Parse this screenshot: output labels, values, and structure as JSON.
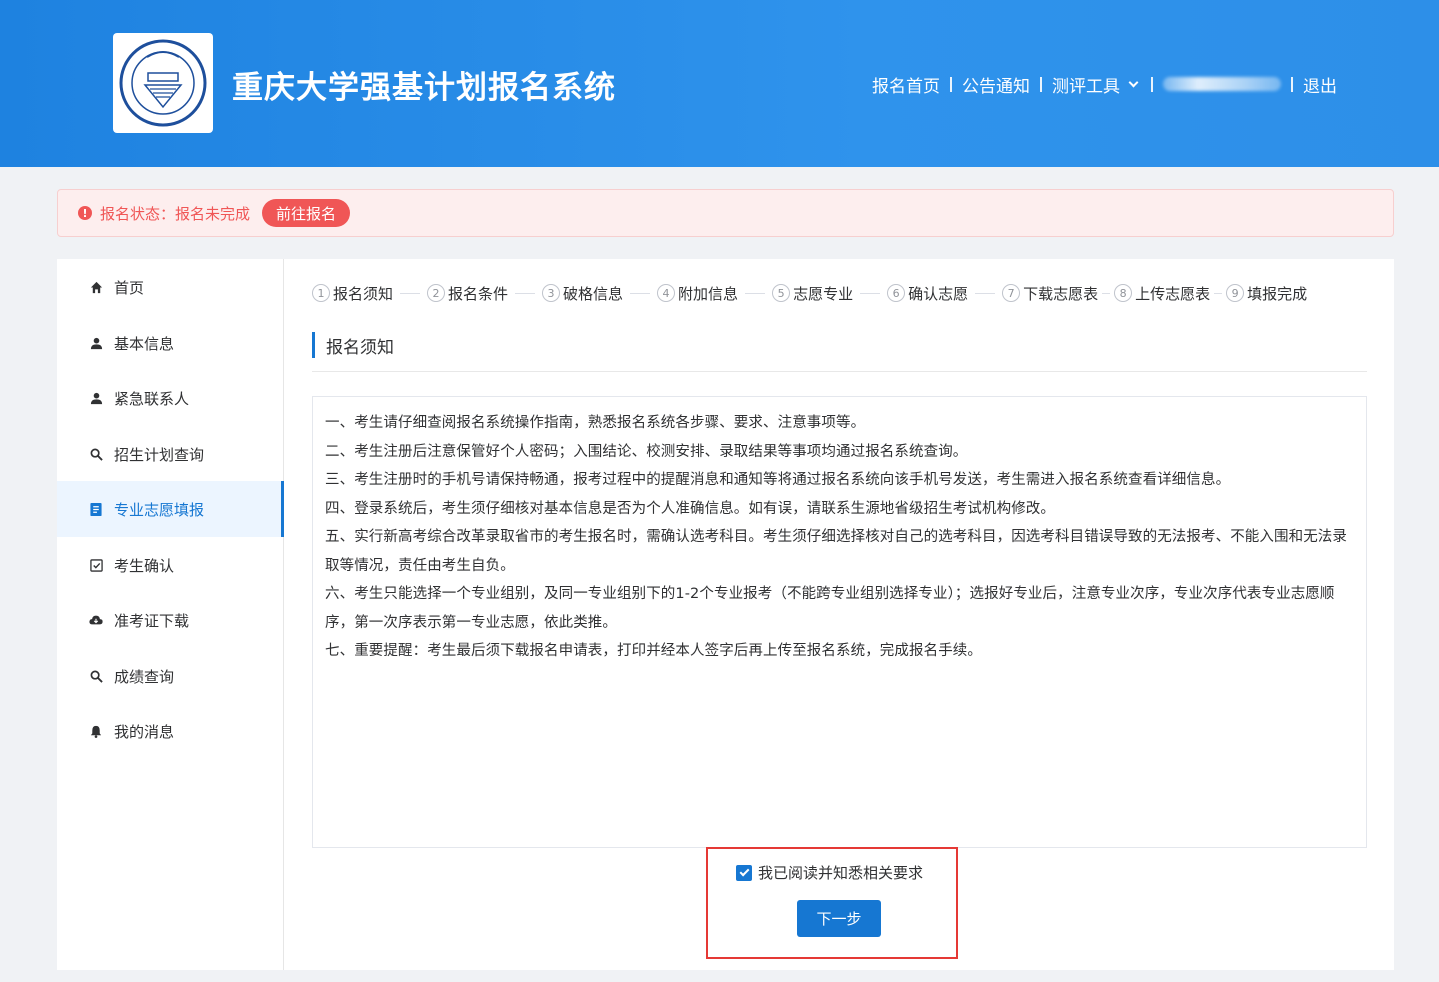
{
  "header": {
    "title": "重庆大学强基计划报名系统",
    "nav": [
      "报名首页",
      "公告通知",
      "测评工具"
    ],
    "logout": "退出"
  },
  "status": {
    "label": "报名状态：报名未完成",
    "button": "前往报名"
  },
  "sidebar": {
    "items": [
      {
        "label": "首页",
        "icon": "home-icon"
      },
      {
        "label": "基本信息",
        "icon": "user-icon"
      },
      {
        "label": "紧急联系人",
        "icon": "user-icon"
      },
      {
        "label": "招生计划查询",
        "icon": "search-icon"
      },
      {
        "label": "专业志愿填报",
        "icon": "document-icon"
      },
      {
        "label": "考生确认",
        "icon": "check-square-icon"
      },
      {
        "label": "准考证下载",
        "icon": "cloud-download-icon"
      },
      {
        "label": "成绩查询",
        "icon": "search-icon"
      },
      {
        "label": "我的消息",
        "icon": "bell-icon"
      }
    ],
    "active_index": 4
  },
  "steps": [
    {
      "num": "1",
      "label": "报名须知"
    },
    {
      "num": "2",
      "label": "报名条件"
    },
    {
      "num": "3",
      "label": "破格信息"
    },
    {
      "num": "4",
      "label": "附加信息"
    },
    {
      "num": "5",
      "label": "志愿专业"
    },
    {
      "num": "6",
      "label": "确认志愿"
    },
    {
      "num": "7",
      "label": "下载志愿表"
    },
    {
      "num": "8",
      "label": "上传志愿表"
    },
    {
      "num": "9",
      "label": "填报完成"
    }
  ],
  "section_title": "报名须知",
  "notice": [
    "一、考生请仔细查阅报名系统操作指南，熟悉报名系统各步骤、要求、注意事项等。",
    "二、考生注册后注意保管好个人密码；入围结论、校测安排、录取结果等事项均通过报名系统查询。",
    "三、考生注册时的手机号请保持畅通，报考过程中的提醒消息和通知等将通过报名系统向该手机号发送，考生需进入报名系统查看详细信息。",
    "四、登录系统后，考生须仔细核对基本信息是否为个人准确信息。如有误，请联系生源地省级招生考试机构修改。",
    "五、实行新高考综合改革录取省市的考生报名时，需确认选考科目。考生须仔细选择核对自己的选考科目，因选考科目错误导致的无法报考、不能入围和无法录取等情况，责任由考生自负。",
    "六、考生只能选择一个专业组别，及同一专业组别下的1-2个专业报考（不能跨专业组别选择专业）；选报好专业后，注意专业次序，专业次序代表专业志愿顺序，第一次序表示第一专业志愿，依此类推。",
    "七、重要提醒：考生最后须下载报名申请表，打印并经本人签字后再上传至报名系统，完成报名手续。"
  ],
  "agree_label": "我已阅读并知悉相关要求",
  "next_button": "下一步",
  "colors": {
    "primary": "#1677d2",
    "danger": "#f05656",
    "header": "#2a8ce6"
  }
}
